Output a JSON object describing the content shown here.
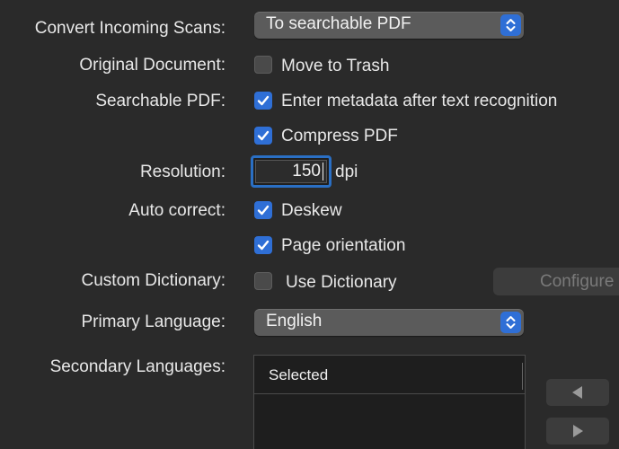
{
  "convert": {
    "label": "Convert Incoming Scans:",
    "value": "To searchable PDF"
  },
  "original": {
    "label": "Original Document:",
    "checkbox_label": "Move to Trash",
    "checked": false
  },
  "searchable": {
    "label": "Searchable PDF:",
    "metadata_label": "Enter metadata after text recognition",
    "metadata_checked": true,
    "compress_label": "Compress PDF",
    "compress_checked": true
  },
  "resolution": {
    "label": "Resolution:",
    "value": "150",
    "unit": "dpi"
  },
  "autocorrect": {
    "label": "Auto correct:",
    "deskew_label": "Deskew",
    "deskew_checked": true,
    "orientation_label": "Page orientation",
    "orientation_checked": true
  },
  "dictionary": {
    "label": "Custom Dictionary:",
    "checkbox_label": "Use Dictionary",
    "checked": false,
    "configure_label": "Configure"
  },
  "primary_language": {
    "label": "Primary Language:",
    "value": "English"
  },
  "secondary_languages": {
    "label": "Secondary Languages:",
    "column_header": "Selected"
  },
  "colors": {
    "accent": "#2f6fd6",
    "background": "#2a2a2a"
  },
  "icons": {
    "stepper": "chevron-up-down-icon",
    "check": "checkmark-icon",
    "move_left": "triangle-left-icon",
    "move_right": "triangle-right-icon"
  }
}
